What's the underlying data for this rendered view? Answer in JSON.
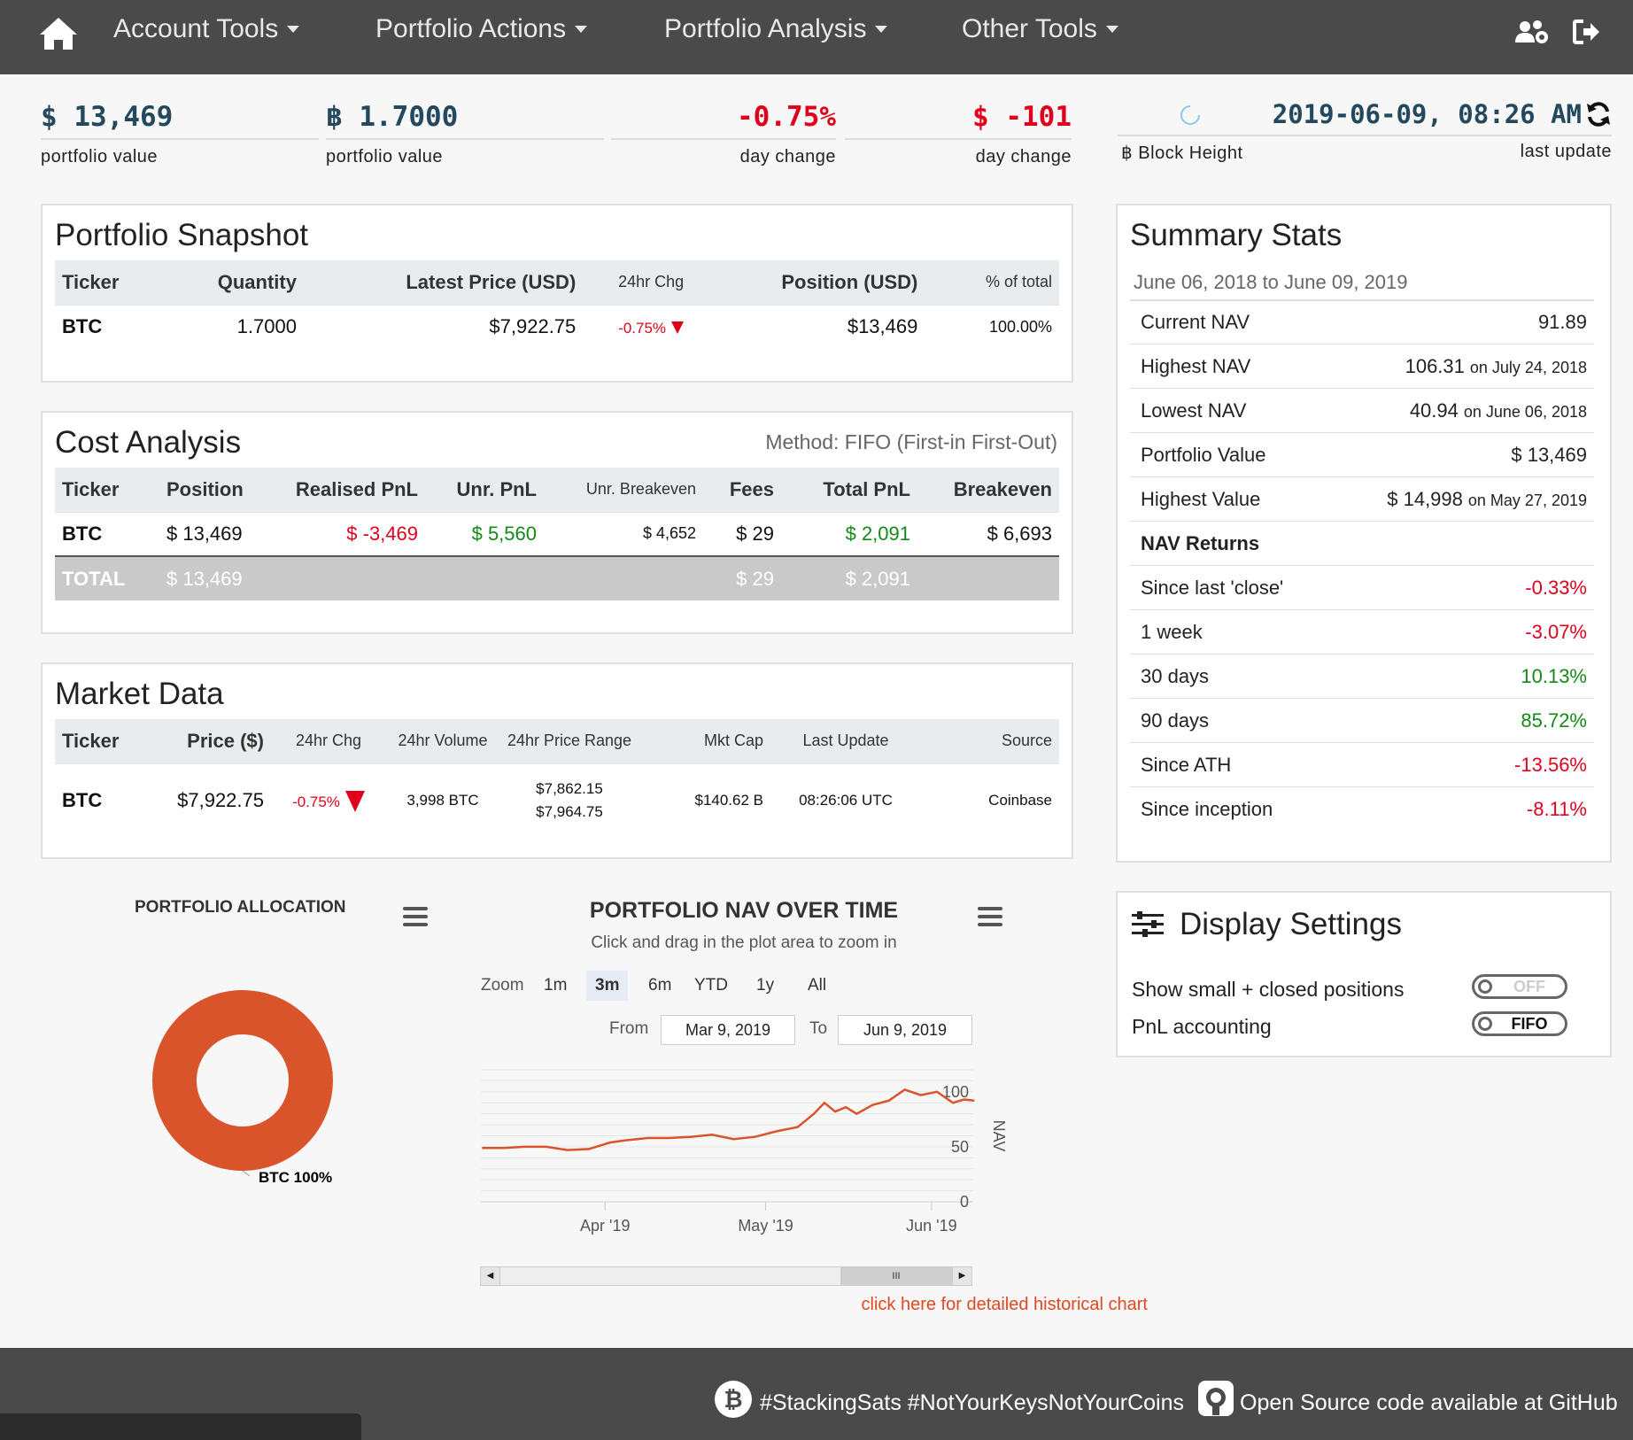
{
  "nav": {
    "items": [
      "Account Tools",
      "Portfolio Actions",
      "Portfolio Analysis",
      "Other Tools"
    ]
  },
  "top_stats": {
    "usd_value": "$ 13,469",
    "usd_label": "portfolio value",
    "btc_value": "฿ 1.7000",
    "btc_label": "portfolio value",
    "pct_change": "-0.75%",
    "pct_label": "day change",
    "usd_change": "$ -101",
    "usd_change_label": "day change",
    "block_label": "฿ Block Height",
    "last_update_value": "2019-06-09, 08:26 AM",
    "last_update_label": "last update"
  },
  "snapshot": {
    "title": "Portfolio Snapshot",
    "headers": [
      "Ticker",
      "Quantity",
      "Latest Price (USD)",
      "24hr Chg",
      "Position (USD)",
      "% of total"
    ],
    "row": [
      "BTC",
      "1.7000",
      "$7,922.75",
      "-0.75%",
      "$13,469",
      "100.00%"
    ]
  },
  "cost": {
    "title": "Cost Analysis",
    "method": "Method: FIFO (First-in First-Out)",
    "headers": [
      "Ticker",
      "Position",
      "Realised PnL",
      "Unr. PnL",
      "Unr. Breakeven",
      "Fees",
      "Total PnL",
      "Breakeven"
    ],
    "row": [
      "BTC",
      "$ 13,469",
      "$ -3,469",
      "$ 5,560",
      "$ 4,652",
      "$ 29",
      "$ 2,091",
      "$ 6,693"
    ],
    "total": [
      "TOTAL",
      "$ 13,469",
      "$ 29",
      "$ 2,091"
    ]
  },
  "market": {
    "title": "Market Data",
    "headers": [
      "Ticker",
      "Price ($)",
      "24hr Chg",
      "24hr Volume",
      "24hr Price Range",
      "Mkt Cap",
      "Last Update",
      "Source"
    ],
    "row": [
      "BTC",
      "$7,922.75",
      "-0.75%",
      "3,998 BTC",
      "$7,862.15",
      "$7,964.75",
      "$140.62 B",
      "08:26:06 UTC",
      "Coinbase"
    ]
  },
  "summary": {
    "title": "Summary Stats",
    "range": "June 06, 2018 to June 09, 2019",
    "rows": [
      {
        "label": "Current NAV",
        "value": "91.89",
        "on": ""
      },
      {
        "label": "Highest NAV",
        "value": "106.31",
        "on": "on July 24, 2018"
      },
      {
        "label": "Lowest NAV",
        "value": "40.94",
        "on": "on June 06, 2018"
      },
      {
        "label": "Portfolio Value",
        "value": "$ 13,469",
        "on": ""
      },
      {
        "label": "Highest Value",
        "value": "$ 14,998",
        "on": "on May 27, 2019"
      }
    ],
    "returns_title": "NAV Returns",
    "returns": [
      {
        "label": "Since last 'close'",
        "value": "-0.33%"
      },
      {
        "label": "1 week",
        "value": "-3.07%"
      },
      {
        "label": "30 days",
        "value": "10.13%"
      },
      {
        "label": "90 days",
        "value": "85.72%"
      },
      {
        "label": "Since ATH",
        "value": "-13.56%"
      },
      {
        "label": "Since inception",
        "value": "-8.11%"
      }
    ]
  },
  "allocation": {
    "title": "PORTFOLIO ALLOCATION",
    "label": "BTC 100%"
  },
  "nav_chart": {
    "title": "PORTFOLIO NAV OVER TIME",
    "subtitle": "Click and drag in the plot area to zoom in",
    "zoom_label": "Zoom",
    "zoom_options": [
      "1m",
      "3m",
      "6m",
      "YTD",
      "1y",
      "All"
    ],
    "zoom_selected": "3m",
    "from_label": "From",
    "from_value": "Mar 9, 2019",
    "to_label": "To",
    "to_value": "Jun 9, 2019",
    "link": "click here for detailed historical chart"
  },
  "chart_data": {
    "type": "line",
    "ylabel": "NAV",
    "ylim": [
      0,
      120
    ],
    "yticks": [
      0,
      50,
      100
    ],
    "xticks": [
      "Apr '19",
      "May '19",
      "Jun '19"
    ],
    "grid": true,
    "series": [
      {
        "color": "#d9542b",
        "x": [
          "2019-03-09",
          "2019-03-13",
          "2019-03-17",
          "2019-03-21",
          "2019-03-25",
          "2019-03-29",
          "2019-04-02",
          "2019-04-05",
          "2019-04-09",
          "2019-04-13",
          "2019-04-17",
          "2019-04-21",
          "2019-04-25",
          "2019-04-29",
          "2019-05-03",
          "2019-05-07",
          "2019-05-10",
          "2019-05-12",
          "2019-05-14",
          "2019-05-16",
          "2019-05-18",
          "2019-05-21",
          "2019-05-24",
          "2019-05-27",
          "2019-05-30",
          "2019-06-02",
          "2019-06-05",
          "2019-06-07",
          "2019-06-09"
        ],
        "values": [
          49,
          49,
          50,
          50,
          47,
          48,
          54,
          56,
          58,
          58,
          59,
          61,
          57,
          59,
          64,
          68,
          80,
          90,
          82,
          86,
          80,
          88,
          92,
          102,
          97,
          100,
          90,
          93,
          92
        ]
      }
    ]
  },
  "settings": {
    "title": "Display Settings",
    "rows": [
      {
        "label": "Show small + closed positions",
        "toggle": "OFF"
      },
      {
        "label": "PnL accounting",
        "toggle": "FIFO"
      }
    ]
  },
  "footer": {
    "tags": "#StackingSats #NotYourKeysNotYourCoins",
    "github": "Open Source code available at GitHub"
  },
  "colors": {
    "navbar": "#4a4a4a",
    "accent": "#24495f",
    "negative": "#e0001c",
    "positive": "#148a16",
    "series": "#d9542b"
  }
}
